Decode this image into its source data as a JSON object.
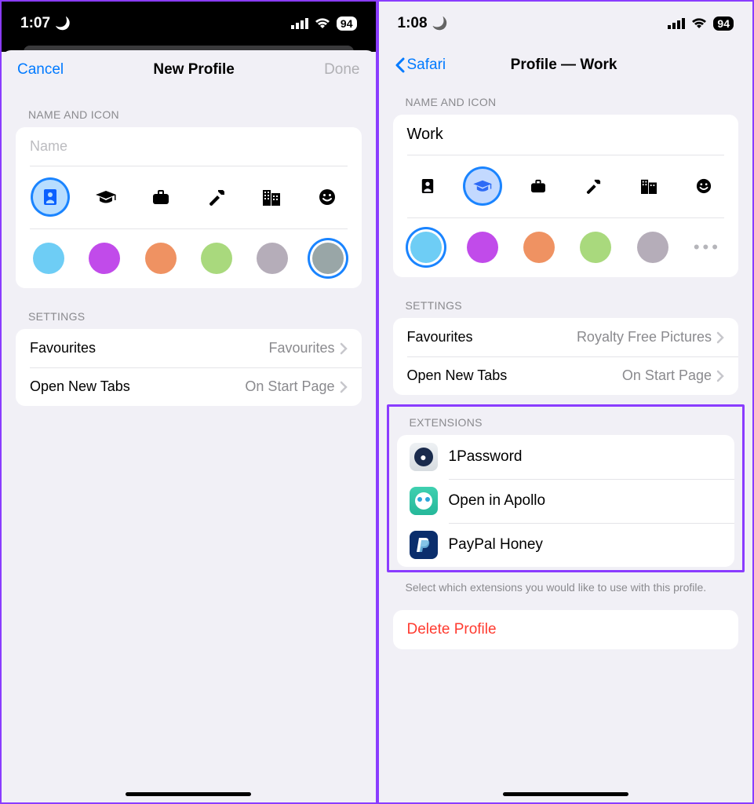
{
  "left": {
    "status": {
      "time": "1:07",
      "battery": "94"
    },
    "nav": {
      "cancel": "Cancel",
      "title": "New Profile",
      "done": "Done"
    },
    "section_name": "NAME AND ICON",
    "name_placeholder": "Name",
    "name_value": "",
    "section_settings": "SETTINGS",
    "settings": [
      {
        "label": "Favourites",
        "value": "Favourites"
      },
      {
        "label": "Open New Tabs",
        "value": "On Start Page"
      }
    ]
  },
  "right": {
    "status": {
      "time": "1:08",
      "battery": "94"
    },
    "nav": {
      "back": "Safari",
      "title": "Profile — Work"
    },
    "section_name": "NAME AND ICON",
    "name_value": "Work",
    "section_settings": "SETTINGS",
    "settings": [
      {
        "label": "Favourites",
        "value": "Royalty Free Pictures"
      },
      {
        "label": "Open New Tabs",
        "value": "On Start Page"
      }
    ],
    "section_ext": "EXTENSIONS",
    "extensions": [
      {
        "label": "1Password"
      },
      {
        "label": "Open in Apollo"
      },
      {
        "label": "PayPal Honey"
      }
    ],
    "ext_footnote": "Select which extensions you would like to use with this profile.",
    "delete": "Delete Profile"
  }
}
